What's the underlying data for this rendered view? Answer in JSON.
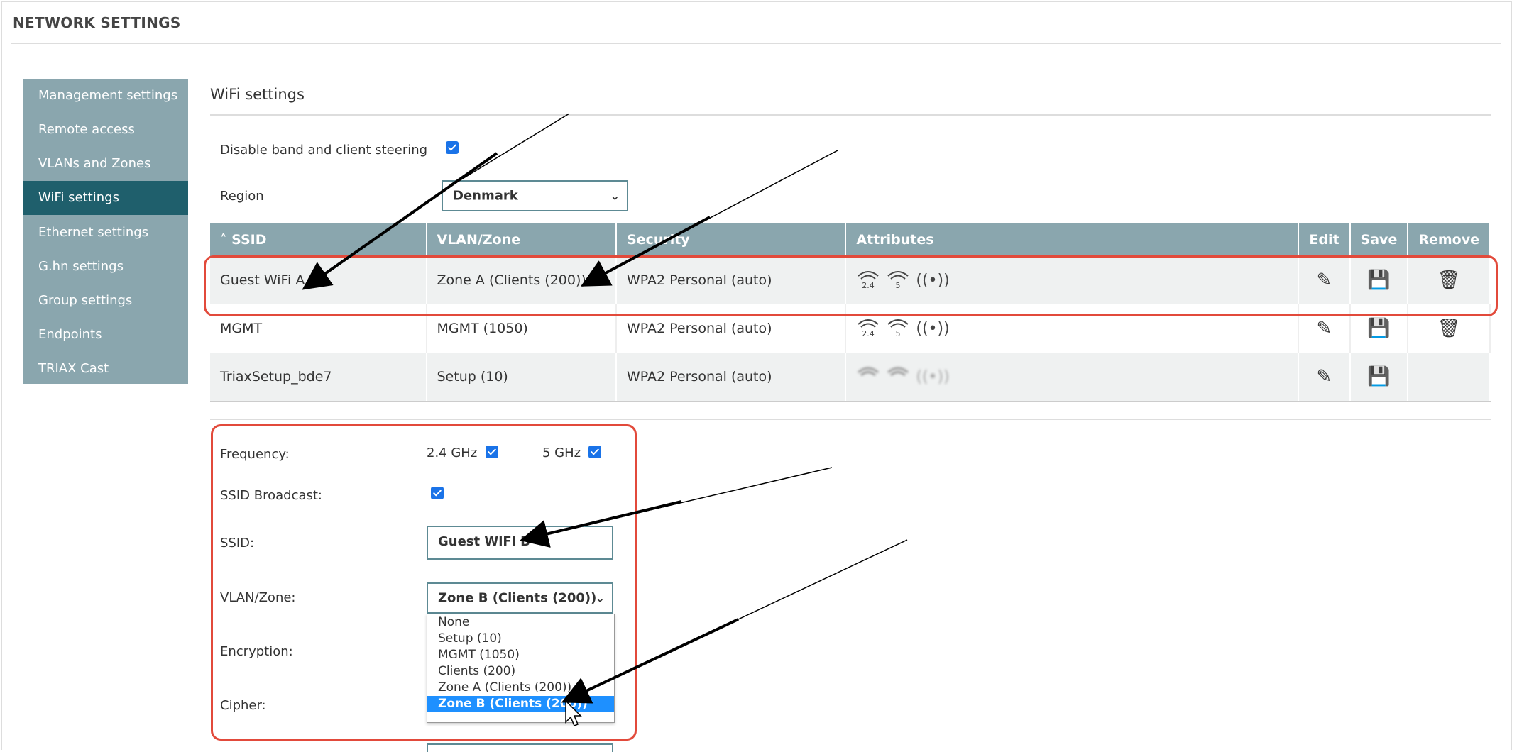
{
  "page": {
    "title": "NETWORK SETTINGS"
  },
  "sidebar": {
    "items": [
      {
        "label": "Management settings"
      },
      {
        "label": "Remote access"
      },
      {
        "label": "VLANs and Zones"
      },
      {
        "label": "WiFi settings",
        "active": true
      },
      {
        "label": "Ethernet settings"
      },
      {
        "label": "G.hn settings"
      },
      {
        "label": "Group settings"
      },
      {
        "label": "Endpoints"
      },
      {
        "label": "TRIAX Cast"
      }
    ]
  },
  "wifi": {
    "section_title": "WiFi settings",
    "steering_label": "Disable band and client steering",
    "steering_checked": true,
    "region_label": "Region",
    "region_value": "Denmark"
  },
  "table": {
    "headers": {
      "ssid": "SSID",
      "vlan": "VLAN/Zone",
      "security": "Security",
      "attributes": "Attributes",
      "edit": "Edit",
      "save": "Save",
      "remove": "Remove"
    },
    "sort_icon": "chevron-up-icon",
    "rows": [
      {
        "ssid": "Guest WiFi A",
        "vlan": "Zone A (Clients (200))",
        "security": "WPA2 Personal (auto)",
        "attributes_active": true,
        "removable": true
      },
      {
        "ssid": "MGMT",
        "vlan": "MGMT (1050)",
        "security": "WPA2 Personal (auto)",
        "attributes_active": true,
        "removable": true
      },
      {
        "ssid": "TriaxSetup_bde7",
        "vlan": "Setup (10)",
        "security": "WPA2 Personal (auto)",
        "attributes_active": false,
        "removable": false
      }
    ],
    "attr_labels": {
      "band24": "2.4",
      "band5": "5",
      "broadcast": "((•))"
    }
  },
  "form": {
    "frequency_label": "Frequency:",
    "freq_24_label": "2.4 GHz",
    "freq_5_label": "5 GHz",
    "freq_24_checked": true,
    "freq_5_checked": true,
    "broadcast_label": "SSID Broadcast:",
    "broadcast_checked": true,
    "ssid_label": "SSID:",
    "ssid_value": "Guest WiFi B",
    "vlan_label": "VLAN/Zone:",
    "vlan_value": "Zone B (Clients (200))",
    "encryption_label": "Encryption:",
    "cipher_label": "Cipher:"
  },
  "vlan_dropdown": {
    "options": [
      "None",
      "Setup (10)",
      "MGMT (1050)",
      "Clients (200)",
      "Zone A (Clients (200))",
      "Zone B (Clients (200))"
    ],
    "selected_index": 5
  },
  "colors": {
    "sidebar_bg": "#8aa6ae",
    "sidebar_active": "#1f5f6c",
    "table_header": "#8aa6ae",
    "highlight_red": "#e24a3b",
    "checkbox_blue": "#1a73e8",
    "dropdown_selected": "#1e90ff"
  }
}
